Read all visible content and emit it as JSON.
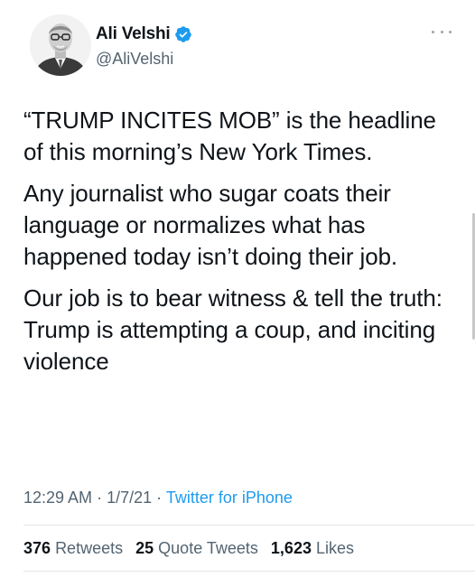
{
  "author": {
    "display_name": "Ali Velshi",
    "handle": "@AliVelshi",
    "verified": true,
    "avatar_icon": "avatar-portrait",
    "verified_icon": "verified-badge-icon"
  },
  "more_icon": "more-options-icon",
  "tweet": {
    "paragraphs": [
      "“TRUMP INCITES MOB” is the headline of this morning’s New York Times.",
      "Any journalist who sugar coats their language or normalizes what has happened today isn’t doing their job.",
      "Our job is to bear witness & tell the truth: Trump is attempting a coup, and inciting violence"
    ]
  },
  "meta": {
    "time": "12:29 AM",
    "separator": "·",
    "date": "1/7/21",
    "source": "Twitter for iPhone"
  },
  "stats": {
    "retweets_count": "376",
    "retweets_label": "Retweets",
    "quotes_count": "25",
    "quotes_label": "Quote Tweets",
    "likes_count": "1,623",
    "likes_label": "Likes"
  },
  "colors": {
    "text": "#0f1419",
    "secondary": "#536471",
    "link": "#1d9bf0",
    "verified": "#1d9bf0"
  }
}
